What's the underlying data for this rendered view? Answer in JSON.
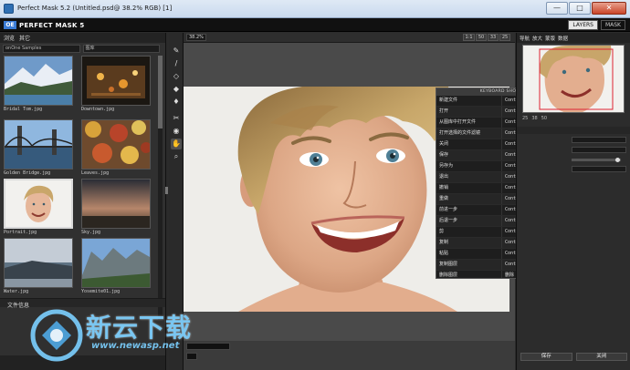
{
  "window": {
    "title": "Perfect Mask 5.2 (Untitled.psd@ 38.2% RGB) [1]",
    "minimize_label": "—",
    "maximize_label": "□",
    "close_label": "✕"
  },
  "app": {
    "logo_mark": "OE",
    "name": "PERFECT MASK 5",
    "modes": [
      "LAYERS",
      "MASK"
    ]
  },
  "left_panel": {
    "tabs": [
      "浏览",
      "其它"
    ],
    "path_left": "onOne Samples",
    "path_right": "图库",
    "thumbnails": [
      {
        "caption": "Bridal Tom.jpg"
      },
      {
        "caption": "Downtown.jpg"
      },
      {
        "caption": "Golden Bridge.jpg"
      },
      {
        "caption": "Leaves.jpg"
      },
      {
        "caption": "Portrait.jpg"
      },
      {
        "caption": "Sky.jpg"
      },
      {
        "caption": "Water.jpg"
      },
      {
        "caption": "Yosemite01.jpg"
      }
    ],
    "info_label": "文件信息"
  },
  "canvas": {
    "zoom_value": "38.2%",
    "view_buttons": [
      "1:1",
      "50",
      "33",
      "25"
    ],
    "bottom_field": "",
    "bottom_field_2": ""
  },
  "shortcuts": {
    "title": "KEYBOARD SHORTCUTS",
    "close_label": "✕",
    "rows": [
      {
        "command": "新建文件",
        "keys": "Control N"
      },
      {
        "command": "打开",
        "keys": "Control O"
      },
      {
        "command": "从图库中打开文件",
        "keys": "Control Shift O"
      },
      {
        "command": "打开选择的文件滤镜",
        "keys": "Control Alt O"
      },
      {
        "command": "关闭",
        "keys": "Control W"
      },
      {
        "command": "保存",
        "keys": "Control S"
      },
      {
        "command": "另存为",
        "keys": "Control Shift S"
      },
      {
        "command": "退出",
        "keys": "Control Q"
      },
      {
        "command": "撤销",
        "keys": "Control Z"
      },
      {
        "command": "重做",
        "keys": "Control Shift Z"
      },
      {
        "command": "前进一步",
        "keys": "Control Alt Z"
      },
      {
        "command": "后退一步",
        "keys": "Control Shift Alt Z"
      },
      {
        "command": "剪",
        "keys": "Control X"
      },
      {
        "command": "复制",
        "keys": "Control C"
      },
      {
        "command": "粘贴",
        "keys": "Control V"
      },
      {
        "command": "复制图层",
        "keys": "Control J"
      },
      {
        "command": "删除图层",
        "keys": "删除"
      }
    ]
  },
  "right_panel": {
    "tabs": [
      "导航",
      "放大",
      "蒙版",
      "数据"
    ],
    "nav_values": [
      "25",
      "38",
      "50"
    ],
    "buttons": [
      "保存",
      "关闭"
    ]
  },
  "watermark": {
    "text": "新云下载",
    "url": "www.newasp.net"
  },
  "colors": {
    "panel_bg": "#2c2c2c",
    "canvas_bg": "#4a4a4a",
    "accent": "#3a7bd5",
    "watermark": "#78c8f5"
  }
}
